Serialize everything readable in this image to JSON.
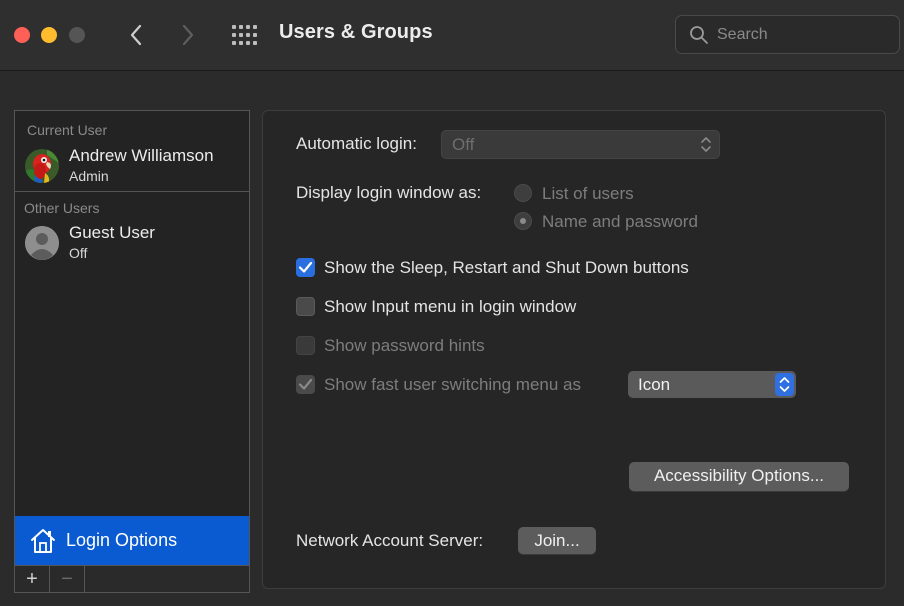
{
  "window": {
    "title": "Users & Groups",
    "search_placeholder": "Search"
  },
  "sidebar": {
    "current_user_header": "Current User",
    "current_user": {
      "name": "Andrew Williamson",
      "role": "Admin"
    },
    "other_users_header": "Other Users",
    "other_users": [
      {
        "name": "Guest User",
        "status": "Off"
      }
    ],
    "login_options_label": "Login Options",
    "add_symbol": "+",
    "remove_symbol": "−"
  },
  "main": {
    "automatic_login_label": "Automatic login:",
    "automatic_login_value": "Off",
    "display_login_label": "Display login window as:",
    "display_options": [
      "List of users",
      "Name and password"
    ],
    "display_selected": "Name and password",
    "checkboxes": [
      {
        "label": "Show the Sleep, Restart and Shut Down buttons",
        "checked": true,
        "enabled": true
      },
      {
        "label": "Show Input menu in login window",
        "checked": false,
        "enabled": true
      },
      {
        "label": "Show password hints",
        "checked": false,
        "enabled": false
      },
      {
        "label": "Show fast user switching menu as",
        "checked": true,
        "enabled": false
      }
    ],
    "fast_switch_value": "Icon",
    "accessibility_button": "Accessibility Options...",
    "network_account_label": "Network Account Server:",
    "join_button": "Join..."
  },
  "colors": {
    "accent": "#0a5bd1",
    "checkbox_blue": "#2a6fe0",
    "close": "#fe5f57",
    "minimize": "#febc2e"
  }
}
